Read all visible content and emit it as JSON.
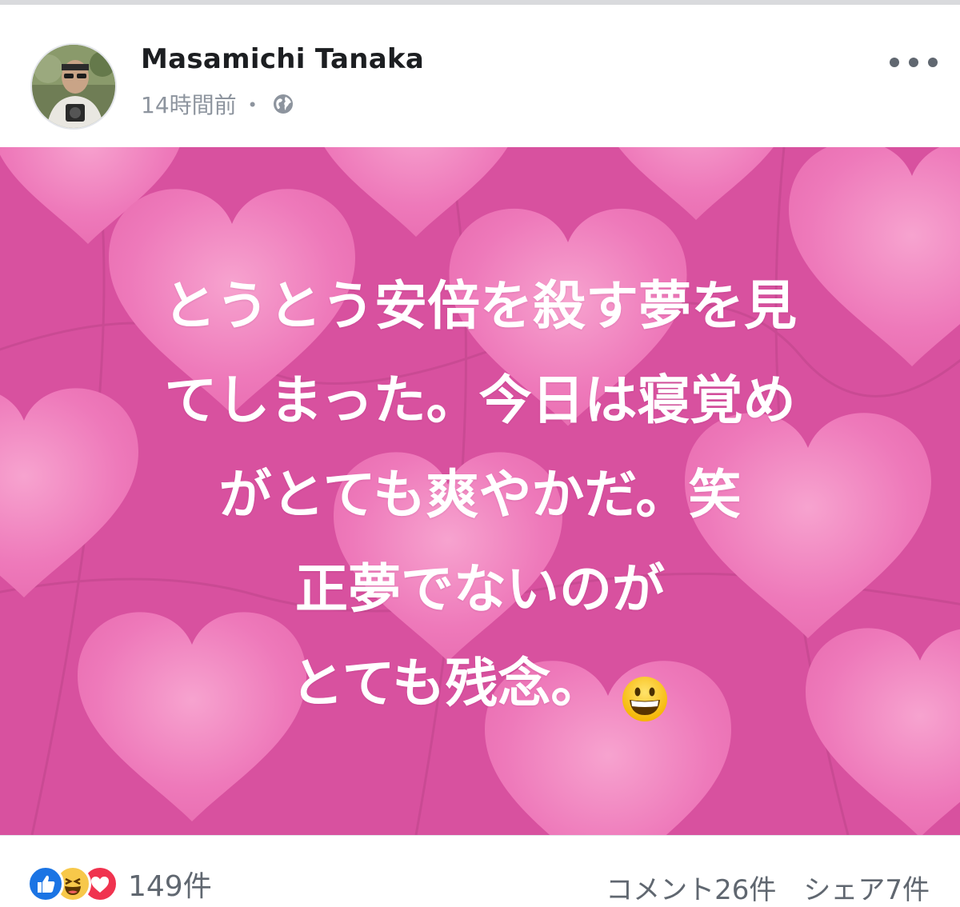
{
  "post": {
    "author": "Masamichi Tanaka",
    "time": "14時間前",
    "separator": "・",
    "visibility_icon": "globe-icon",
    "more_icon": "more-options-icon",
    "background_color": "#d8519f",
    "text_lines": [
      "とうとう安倍を殺す夢を見",
      "てしまった。今日は寝覚め",
      "がとても爽やかだ。笑",
      "正夢でないのが",
      "とても残念。"
    ],
    "emoji": "grinning-face-emoji"
  },
  "footer": {
    "reaction_icons": [
      "like-icon",
      "haha-icon",
      "love-icon"
    ],
    "reaction_count": "149件",
    "comments": "コメント26件",
    "shares": "シェア7件"
  }
}
